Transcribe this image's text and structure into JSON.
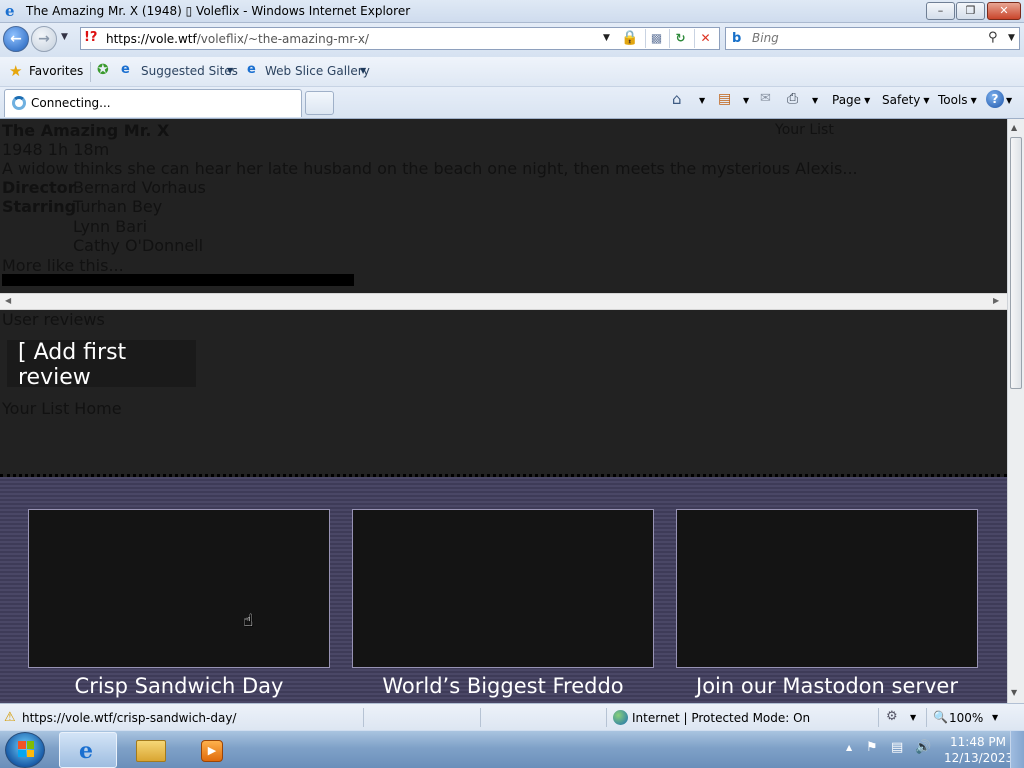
{
  "window": {
    "title": "The Amazing Mr. X (1948) ▯ Voleflix - Windows Internet Explorer",
    "minimize": "–",
    "maximize": "❐",
    "close": "✕"
  },
  "address_bar": {
    "url_host": "https://vole.wtf",
    "url_path": "/voleflix/~the-amazing-mr-x/",
    "search_placeholder": "Bing",
    "icons": [
      "back-arrow-icon",
      "forward-arrow-icon",
      "certificate-error-icon",
      "lock-icon",
      "compatibility-icon",
      "refresh-icon",
      "stop-icon",
      "bing-icon",
      "search-icon"
    ]
  },
  "favorites_bar": {
    "favorites_label": "Favorites",
    "items": [
      {
        "label": "Suggested Sites"
      },
      {
        "label": "Web Slice Gallery"
      }
    ]
  },
  "tab_bar": {
    "active_tab_label": "Connecting...",
    "commands": {
      "page": "Page",
      "safety": "Safety",
      "tools": "Tools",
      "help": "?"
    }
  },
  "page": {
    "movie": {
      "title": "The Amazing Mr. X",
      "meta": "1948 1h 18m",
      "description": "A widow thinks she can hear her late husband on the beach one night, then meets the mysterious Alexis...",
      "director_label": "Director",
      "director": "Bernard Vorhaus",
      "starring_label": "Starring",
      "cast": [
        "Turhan Bey",
        "Lynn Bari",
        "Cathy O'Donnell"
      ],
      "more_like": "More like this..."
    },
    "your_list_link": "Your List",
    "reviews_heading": "User reviews",
    "add_review_button": "[ Add first review",
    "footer_nav": "Your List Home",
    "promos": [
      {
        "title": "Crisp Sandwich Day"
      },
      {
        "title": "World’s Biggest Freddo"
      },
      {
        "title": "Join our Mastodon server"
      }
    ]
  },
  "status_bar": {
    "url": "https://vole.wtf/crisp-sandwich-day/",
    "zone": "Internet | Protected Mode: On",
    "zoom": "100%"
  },
  "taskbar": {
    "time": "11:48 PM",
    "date": "12/13/2023",
    "pinned": [
      "internet-explorer",
      "windows-explorer",
      "media-player"
    ]
  },
  "colors": {
    "page_background": "#222222",
    "promo_background": "#4a4766",
    "promo_card": "#141414",
    "titlebar": "#dfe9f5",
    "taskbar": "#7fa1c8"
  }
}
